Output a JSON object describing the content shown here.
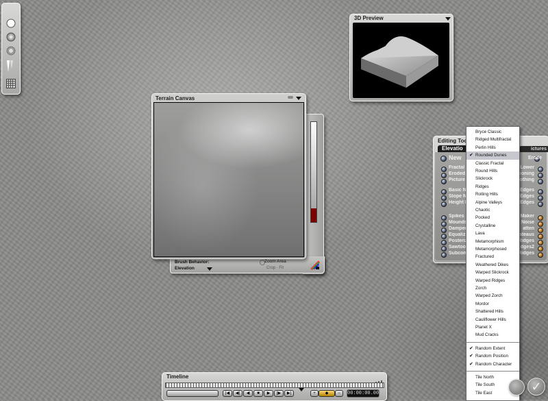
{
  "toolbar": {
    "buttons": [
      "sphere-brush-icon",
      "soft-brush-icon",
      "speckle-brush-icon",
      "gradient-brush-icon",
      "grid-icon"
    ]
  },
  "preview": {
    "title": "3D Preview"
  },
  "terrain_canvas": {
    "title": "Terrain Canvas",
    "brush_behavior_label": "Brush Behavior:",
    "brush_behavior_value": "Elevation",
    "zoom_area": "Zoom Area",
    "crop_fit": "Crop · Fit"
  },
  "editing_tools": {
    "title": "Editing Too",
    "tab_elevation": "Elevatio",
    "tab_pictures": "ictures",
    "new_label": "New",
    "erode_label": "Erode",
    "left_items": [
      "Fractal",
      "Eroded",
      "Picture",
      "Basic N",
      "Slope N",
      "Height N",
      "Spikes",
      "Mounds",
      "Dampen",
      "Equaliz",
      "Posteriz",
      "Sawtoot",
      "Subcont"
    ],
    "right_items": [
      "/Lower",
      "poning",
      "othing",
      "Edges",
      "Edges",
      "Edges",
      "Maker",
      "Noise",
      "atten",
      "ateaus",
      "Ridges",
      "dges2",
      "Ridges"
    ]
  },
  "menu": {
    "items": [
      "Bryce Classic",
      "Ridged Multifractal",
      "Perlin Hills",
      "Rounded Dunes",
      "Classic Fractal",
      "Round Hills",
      "Slickrock",
      "Ridges",
      "Rolling Hills",
      "Alpine Valleys",
      "Chaotic",
      "Pocked",
      "Crystalline",
      "Lava",
      "Metamorphism",
      "Metamorphosed",
      "Fractured",
      "Weathered Dikes",
      "Warped Slickrock",
      "Warped Ridges",
      "Zorch",
      "Warped Zorch",
      "Mordor",
      "Shattered Hills",
      "Cauliflower Hills",
      "Planet X",
      "Mud Cracks"
    ],
    "selected": "Rounded Dunes",
    "options": [
      "Random Extent",
      "Random Position",
      "Random Character"
    ],
    "tile_items": [
      "Tile North",
      "Tile South",
      "Tile East"
    ]
  },
  "timeline": {
    "title": "Timeline",
    "time": "00:00:00.00",
    "buttons": [
      "|◀",
      "◀|",
      "◀",
      "■",
      "▶",
      "|▶",
      "▶|"
    ]
  },
  "corner": {
    "cancel": "",
    "confirm": "✓"
  },
  "colors": {
    "background": "#8b8b89",
    "slider_fill": "#7a0000"
  }
}
